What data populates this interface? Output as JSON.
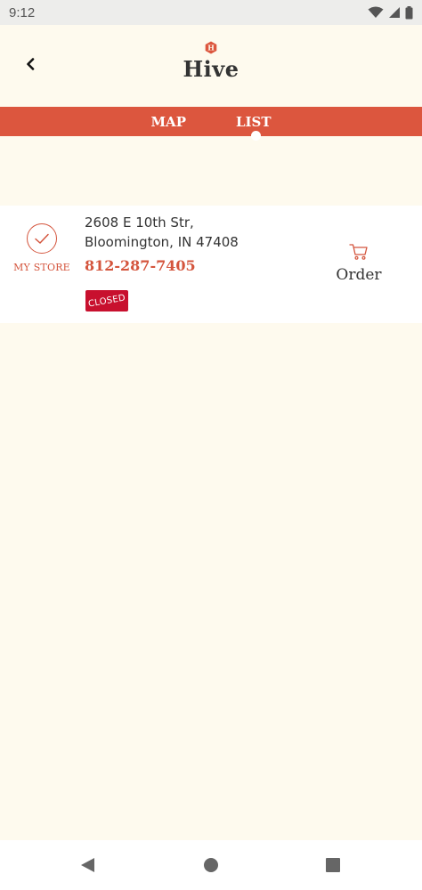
{
  "status_bar": {
    "time": "9:12",
    "icons": [
      "wifi-icon",
      "signal-icon",
      "battery-icon"
    ]
  },
  "header": {
    "back_icon": "chevron-left-icon",
    "logo_letter": "H",
    "title": "Hive"
  },
  "tabs": [
    {
      "label": "MAP",
      "selected": false
    },
    {
      "label": "LIST",
      "selected": true
    }
  ],
  "store": {
    "my_store_label": "MY STORE",
    "address_line1": "2608 E 10th Str,",
    "address_line2": "Bloomington, IN 47408",
    "phone": "812-287-7405",
    "status": "CLOSED",
    "order_label": "Order"
  },
  "nav_bar": {
    "buttons": [
      "back-triangle-icon",
      "home-circle-icon",
      "recents-square-icon"
    ]
  },
  "colors": {
    "accent": "#dc563e",
    "text_accent": "#d4553d",
    "closed_badge": "#c8102e",
    "background": "#fefaee",
    "card": "#ffffff"
  }
}
